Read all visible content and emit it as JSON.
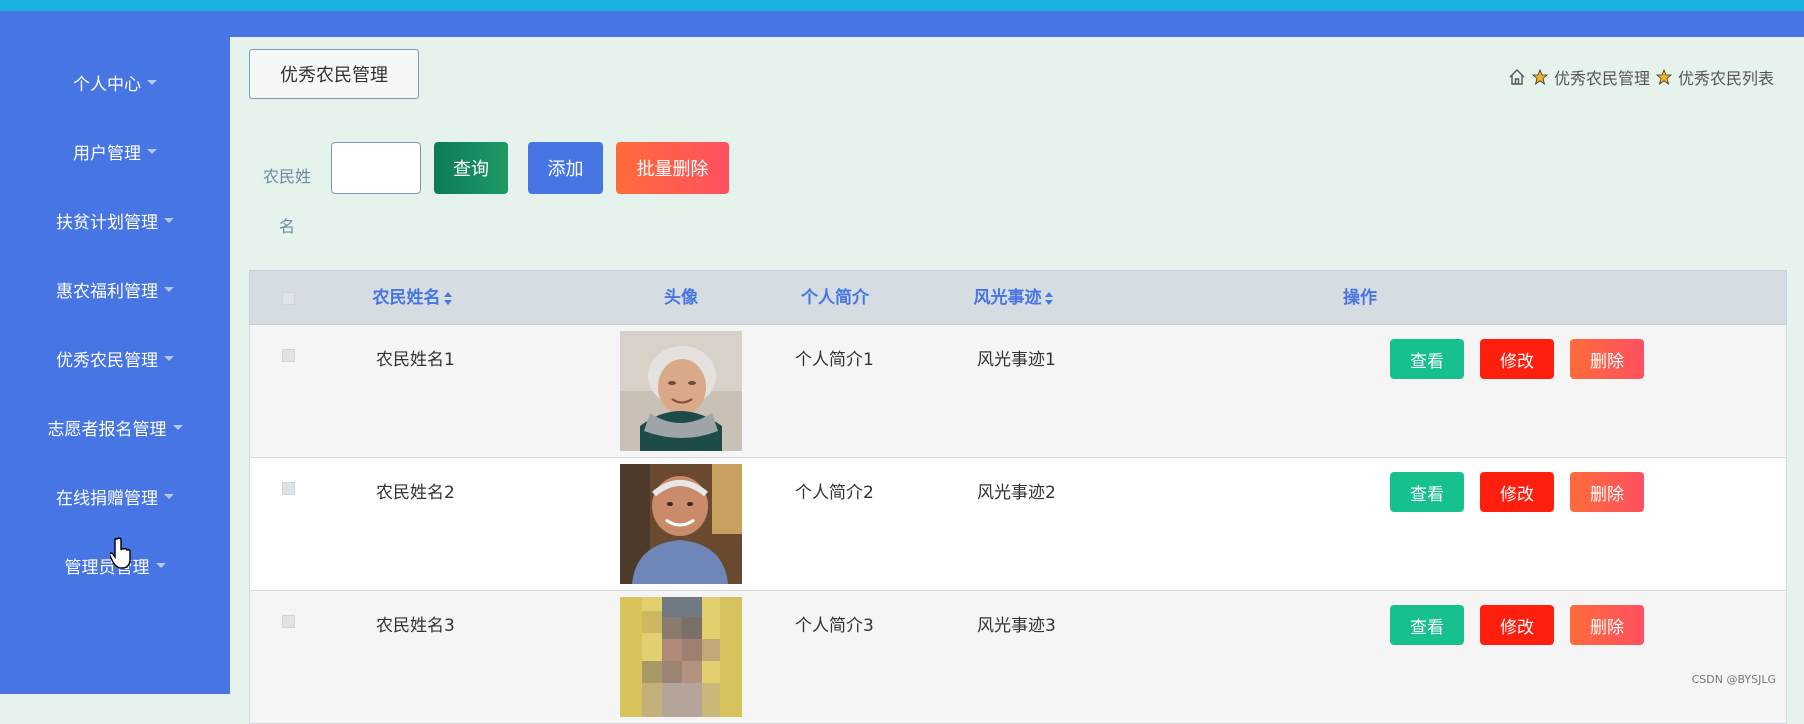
{
  "sidebar": {
    "items": [
      {
        "label": "个人中心"
      },
      {
        "label": "用户管理"
      },
      {
        "label": "扶贫计划管理"
      },
      {
        "label": "惠农福利管理"
      },
      {
        "label": "优秀农民管理"
      },
      {
        "label": "志愿者报名管理"
      },
      {
        "label": "在线捐赠管理"
      },
      {
        "label": "管理员管理"
      }
    ]
  },
  "header": {
    "page_title": "优秀农民管理",
    "breadcrumb": [
      "优秀农民管理",
      "优秀农民列表"
    ]
  },
  "search": {
    "label": "农民姓名",
    "value": "",
    "query_label": "查询",
    "add_label": "添加",
    "bulk_delete_label": "批量删除"
  },
  "table": {
    "columns": [
      "农民姓名",
      "头像",
      "个人简介",
      "风光事迹",
      "操作"
    ],
    "rows": [
      {
        "name": "农民姓名1",
        "intro": "个人简介1",
        "deeds": "风光事迹1",
        "avatar": "elderly-woman-photo"
      },
      {
        "name": "农民姓名2",
        "intro": "个人简介2",
        "deeds": "风光事迹2",
        "avatar": "elderly-man-photo"
      },
      {
        "name": "农民姓名3",
        "intro": "个人简介3",
        "deeds": "风光事迹3",
        "avatar": "pixelated-photo"
      }
    ],
    "actions": {
      "view": "查看",
      "edit": "修改",
      "delete": "删除"
    }
  },
  "colors": {
    "sidebar": "#4775e3",
    "top_strip": "#19b2e0",
    "content_bg": "#e6f2ec",
    "view_button": "#16c08f",
    "edit_button": "#ff1f0f",
    "delete_button": "#ff5a4e"
  },
  "watermark": "CSDN @BYSJLG"
}
